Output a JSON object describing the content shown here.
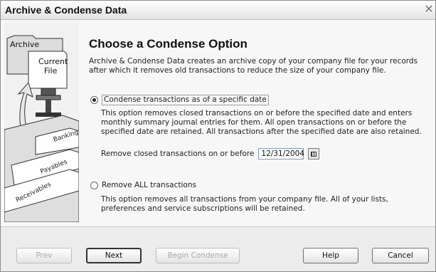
{
  "window": {
    "title": "Archive & Condense Data",
    "close_glyph": "✕"
  },
  "graphic": {
    "archive_label": "Archive",
    "current_label_1": "Current",
    "current_label_2": "File",
    "tab_banking": "Banking",
    "tab_payables": "Payables",
    "tab_receivables": "Receivables"
  },
  "main": {
    "heading": "Choose a Condense Option",
    "intro": "Archive & Condense Data creates an archive copy of your company file for your records after which it removes old transactions to reduce the size of your company file.",
    "option1": {
      "label": "Condense transactions as of a specific date",
      "selected": true,
      "description": "This option removes closed transactions on or before the specified date and enters monthly summary journal entries for them.  All open transactions on or before the specified date are retained.  All transactions after the specified date are also retained.",
      "date_label": "Remove closed transactions on or before",
      "date_value": "12/31/2004",
      "calendar_icon": "calendar-icon"
    },
    "option2": {
      "label": "Remove ALL transactions",
      "selected": false,
      "description": "This option removes all transactions from your company file.  All of your lists, preferences and service subscriptions will be retained."
    }
  },
  "buttons": {
    "prev": "Prev",
    "next": "Next",
    "begin": "Begin Condense",
    "help": "Help",
    "cancel": "Cancel"
  }
}
